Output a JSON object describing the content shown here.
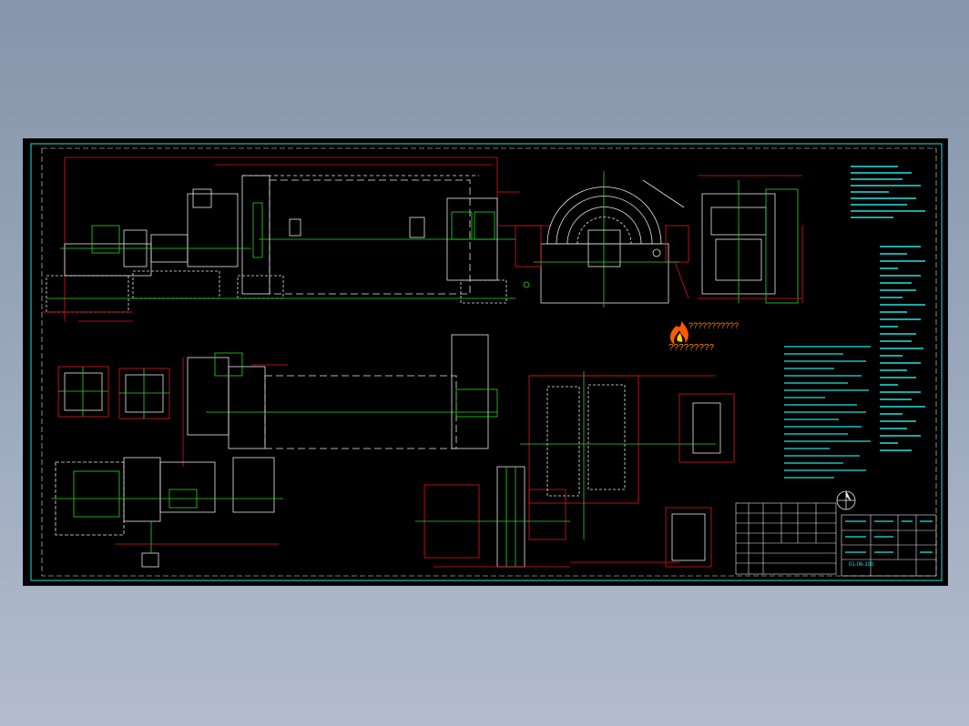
{
  "drawing": {
    "watermark_label": "???????????",
    "watermark_caption": "?????????",
    "title_block_label": "01-06-100"
  },
  "colors": {
    "page_background": "#8e9cb2",
    "model_space": "#000000",
    "frame": "#24e0e0",
    "red_lines": "#e0161e",
    "green_lines": "#29d61f",
    "white_lines": "#e6e6e6",
    "cyan_text": "#24e0e0",
    "watermark": "#ff8a00"
  },
  "icons": {
    "logo": "flame-logo-icon",
    "compass": "north-arrow-icon"
  }
}
